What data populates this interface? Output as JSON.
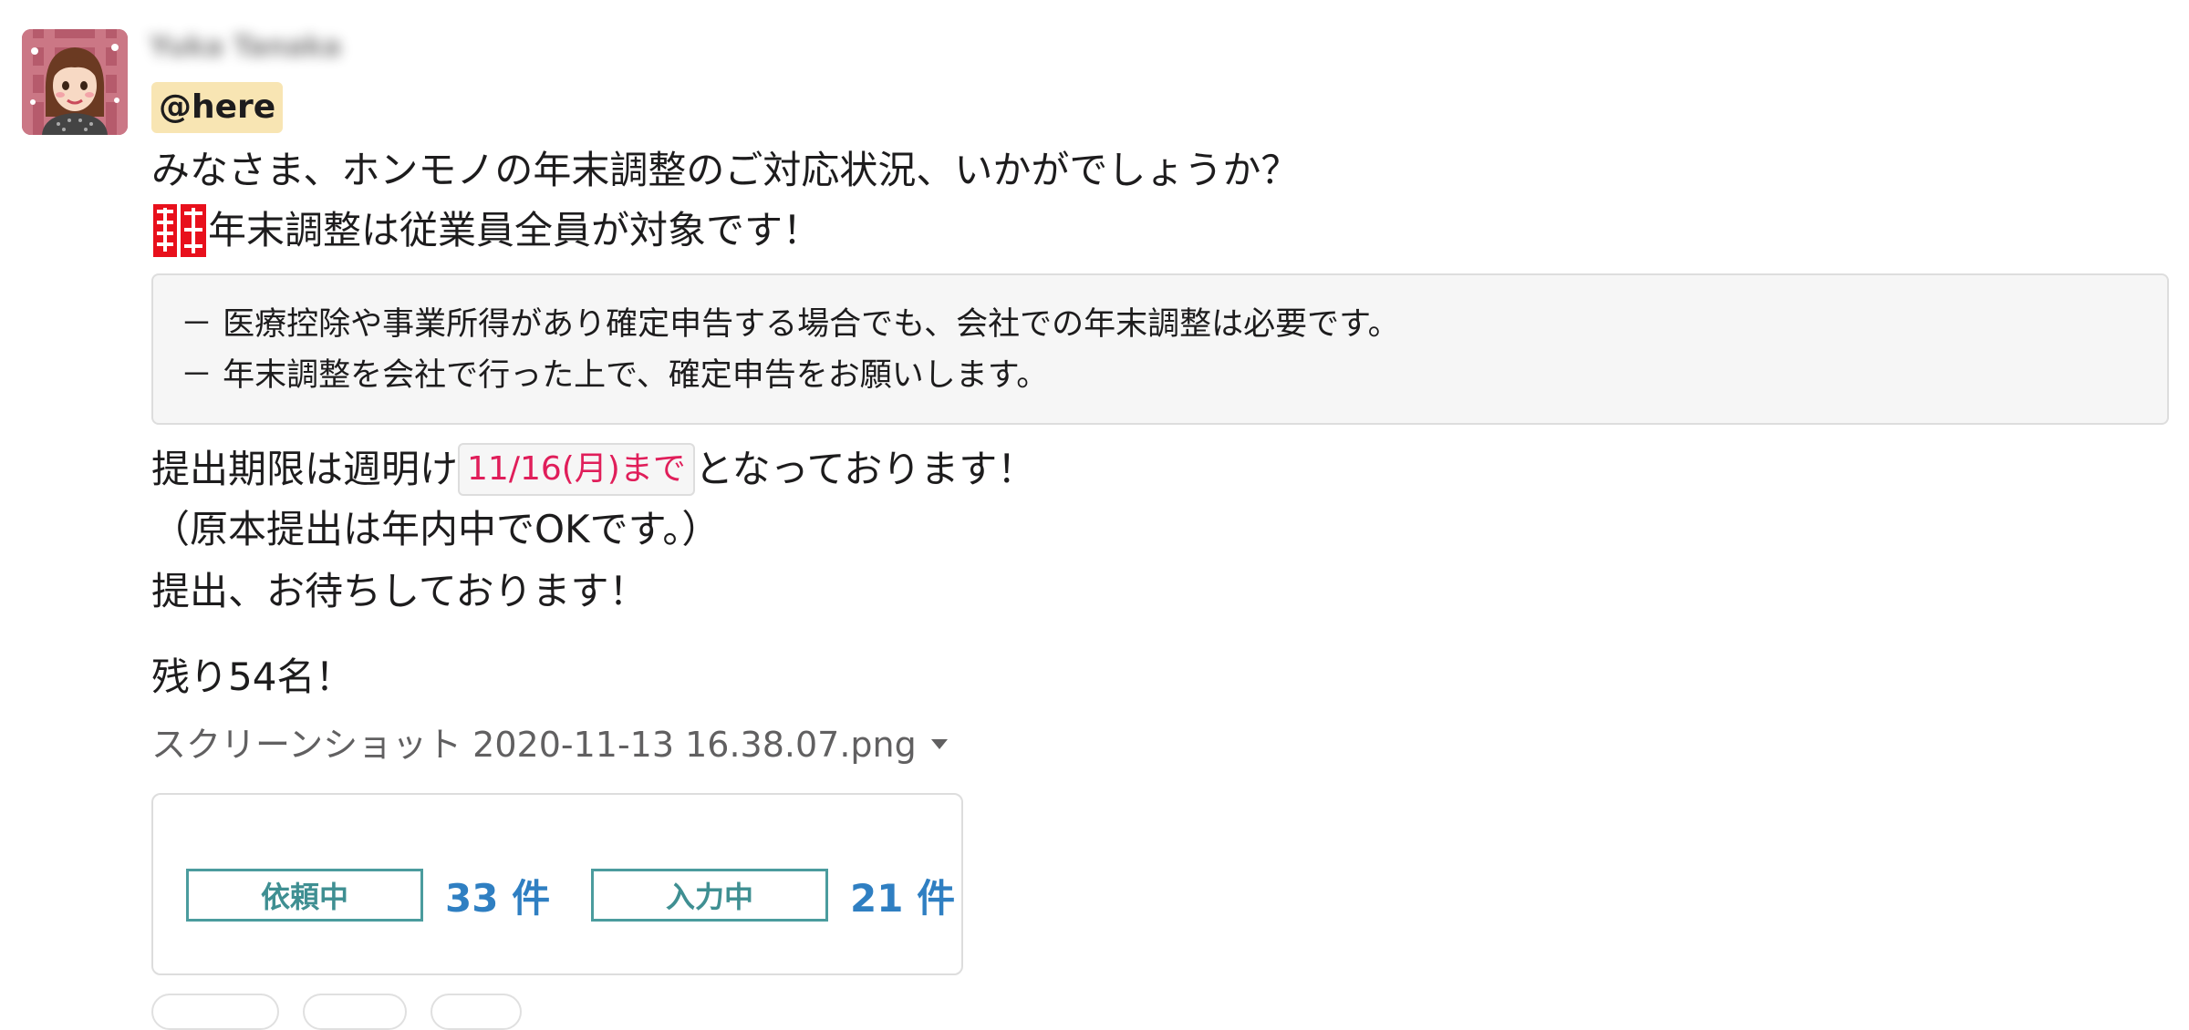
{
  "message": {
    "sender_name": "Yuka Tanaka",
    "mention": "@here",
    "line1": "みなさま、ホンモノの年末調整のご対応状況、いかがでしょうか？",
    "line2_emoji": "emoji-kanji-red",
    "line2": "年末調整は従業員全員が対象です！",
    "quote_lines": [
      "－ 医療控除や事業所得があり確定申告する場合でも、会社での年末調整は必要です。",
      "－ 年末調整を会社で行った上で、確定申告をお願いします。"
    ],
    "line3_before": "提出期限は週明け",
    "line3_code": "11/16(月)まで",
    "line3_after": "となっております！",
    "line4": "（原本提出は年内中でOKです。）",
    "line5": "提出、お待ちしております！",
    "line6": "残り54名！"
  },
  "attachment": {
    "filename": "スクリーンショット 2020-11-13 16.38.07.png",
    "caret_icon": "chevron-down-icon",
    "statuses": [
      {
        "label": "依頼中",
        "count": "33 件"
      },
      {
        "label": "入力中",
        "count": "21 件"
      }
    ]
  },
  "colors": {
    "mention_bg": "#f8e5b3",
    "code_text": "#e01e5a",
    "status_border": "#4b9c9e",
    "status_count": "#2f7fc2"
  }
}
